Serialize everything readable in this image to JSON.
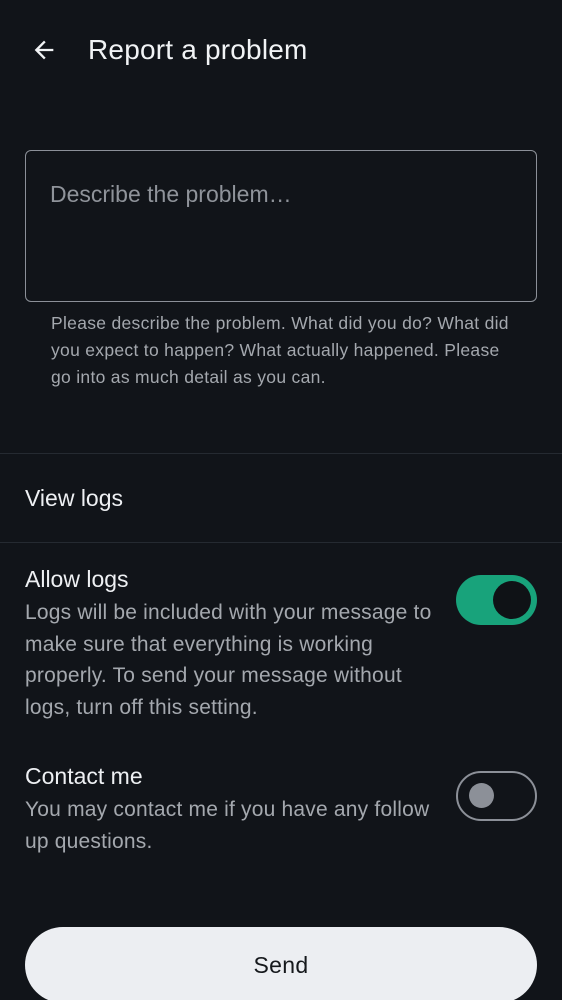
{
  "header": {
    "title": "Report a problem",
    "back_icon": "arrow-left-icon"
  },
  "description": {
    "placeholder": "Describe the problem…",
    "value": "",
    "helper": "Please describe the problem. What did you do? What did you expect to happen? What actually happened. Please go into as much detail as you can."
  },
  "view_logs": {
    "label": "View logs"
  },
  "allow_logs": {
    "title": "Allow logs",
    "description": "Logs will be included with your message to make sure that everything is working properly. To send your message without logs, turn off this setting.",
    "enabled": true
  },
  "contact_me": {
    "title": "Contact me",
    "description": "You may contact me if you have any follow up questions.",
    "enabled": false
  },
  "send": {
    "label": "Send"
  },
  "colors": {
    "background": "#111419",
    "accent": "#18a37b",
    "button_bg": "#eceef2"
  }
}
